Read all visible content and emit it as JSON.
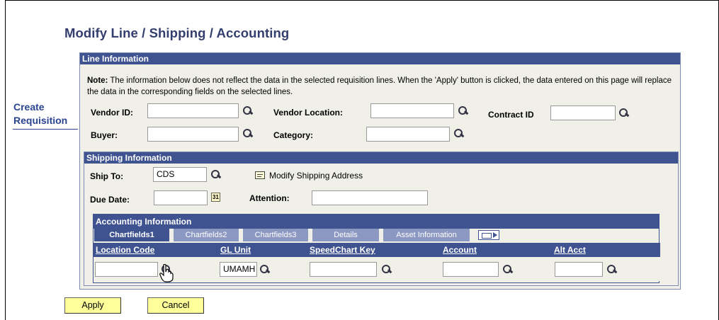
{
  "page_title": "Modify Line / Shipping / Accounting",
  "side_link": {
    "line1": "Create",
    "line2": "Requisition"
  },
  "line_info": {
    "header": "Line Information",
    "note_bold": "Note:",
    "note_text": " The information below does not reflect the data in the selected requisition lines. When the 'Apply' button is clicked, the data entered on this page will replace the data in the corresponding fields on the selected lines.",
    "vendor_id_label": "Vendor ID:",
    "vendor_id_value": "",
    "vendor_location_label": "Vendor Location:",
    "vendor_location_value": "",
    "contract_id_label": "Contract ID",
    "contract_id_value": "",
    "buyer_label": "Buyer:",
    "buyer_value": "",
    "category_label": "Category:",
    "category_value": ""
  },
  "shipping": {
    "header": "Shipping Information",
    "ship_to_label": "Ship To:",
    "ship_to_value": "CDS",
    "modify_address_label": "Modify Shipping Address",
    "due_date_label": "Due Date:",
    "due_date_value": "",
    "calendar_glyph": "31",
    "attention_label": "Attention:",
    "attention_value": ""
  },
  "accounting": {
    "header": "Accounting Information",
    "tabs": [
      "Chartfields1",
      "Chartfields2",
      "Chartfields3",
      "Details",
      "Asset Information"
    ],
    "columns": [
      "Location Code",
      "GL Unit",
      "SpeedChart Key",
      "Account",
      "Alt Acct"
    ],
    "row": {
      "location_code": "",
      "gl_unit": "UMAMH",
      "speedchart_key": "",
      "account": "",
      "alt_acct": ""
    }
  },
  "buttons": {
    "apply": "Apply",
    "cancel": "Cancel"
  },
  "colors": {
    "header_blue": "#3f5391",
    "title_blue": "#343e6e",
    "panel_bg": "#f0f0e8",
    "button_yellow": "#ffff99"
  }
}
